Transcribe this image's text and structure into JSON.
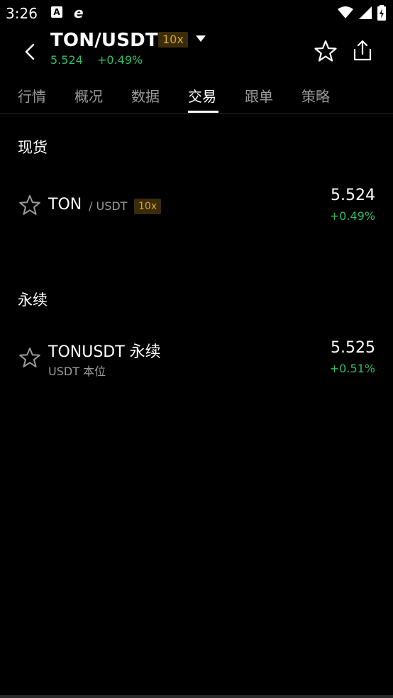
{
  "status_bar": {
    "time": "3:26",
    "app_icon_a": "A"
  },
  "header": {
    "title": "TON/USDT",
    "leverage": "10x",
    "price": "5.524",
    "change": "+0.49%"
  },
  "tabs": [
    {
      "label": "行情"
    },
    {
      "label": "概况"
    },
    {
      "label": "数据"
    },
    {
      "label": "交易"
    },
    {
      "label": "跟单"
    },
    {
      "label": "策略"
    }
  ],
  "active_tab": "交易",
  "spot": {
    "section_title": "现货",
    "name": "TON",
    "quote": "/ USDT",
    "leverage": "10x",
    "price": "5.524",
    "change": "+0.49%"
  },
  "perpetual": {
    "section_title": "永续",
    "name": "TONUSDT 永续",
    "subtitle": "USDT 本位",
    "price": "5.525",
    "change": "+0.51%"
  },
  "colors": {
    "up": "#2ebd6b",
    "badge_bg": "#3a2c08",
    "badge_text": "#d7a431",
    "muted": "#9a9a9a"
  }
}
